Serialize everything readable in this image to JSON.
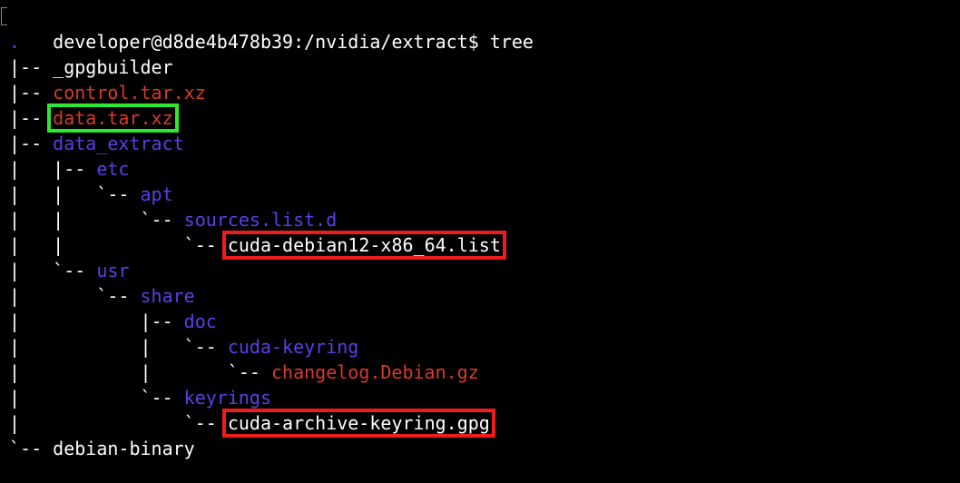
{
  "terminal": {
    "prompt": "developer@d8de4b478b39:/nvidia/extract$ ",
    "command": "tree"
  },
  "colors": {
    "directory": "#5b3fe8",
    "archive": "#d63a2c",
    "file": "#ffffff",
    "highlight_green": "#2ee82e",
    "highlight_red": "#ee1c1c"
  },
  "tree": [
    {
      "prefix": "",
      "name": ".",
      "type": "directory"
    },
    {
      "prefix": "|-- ",
      "name": "_gpgbuilder",
      "type": "file"
    },
    {
      "prefix": "|-- ",
      "name": "control.tar.xz",
      "type": "archive"
    },
    {
      "prefix": "|-- ",
      "name": "data.tar.xz",
      "type": "archive",
      "highlight": "green"
    },
    {
      "prefix": "|-- ",
      "name": "data_extract",
      "type": "directory"
    },
    {
      "prefix": "|   |-- ",
      "name": "etc",
      "type": "directory"
    },
    {
      "prefix": "|   |   `-- ",
      "name": "apt",
      "type": "directory"
    },
    {
      "prefix": "|   |       `-- ",
      "name": "sources.list.d",
      "type": "directory"
    },
    {
      "prefix": "|   |           `-- ",
      "name": "cuda-debian12-x86_64.list",
      "type": "file",
      "highlight": "red"
    },
    {
      "prefix": "|   `-- ",
      "name": "usr",
      "type": "directory"
    },
    {
      "prefix": "|       `-- ",
      "name": "share",
      "type": "directory"
    },
    {
      "prefix": "|           |-- ",
      "name": "doc",
      "type": "directory"
    },
    {
      "prefix": "|           |   `-- ",
      "name": "cuda-keyring",
      "type": "directory"
    },
    {
      "prefix": "|           |       `-- ",
      "name": "changelog.Debian.gz",
      "type": "archive"
    },
    {
      "prefix": "|           `-- ",
      "name": "keyrings",
      "type": "directory"
    },
    {
      "prefix": "|               `-- ",
      "name": "cuda-archive-keyring.gpg",
      "type": "file",
      "highlight": "red"
    },
    {
      "prefix": "`-- ",
      "name": "debian-binary",
      "type": "file"
    }
  ]
}
